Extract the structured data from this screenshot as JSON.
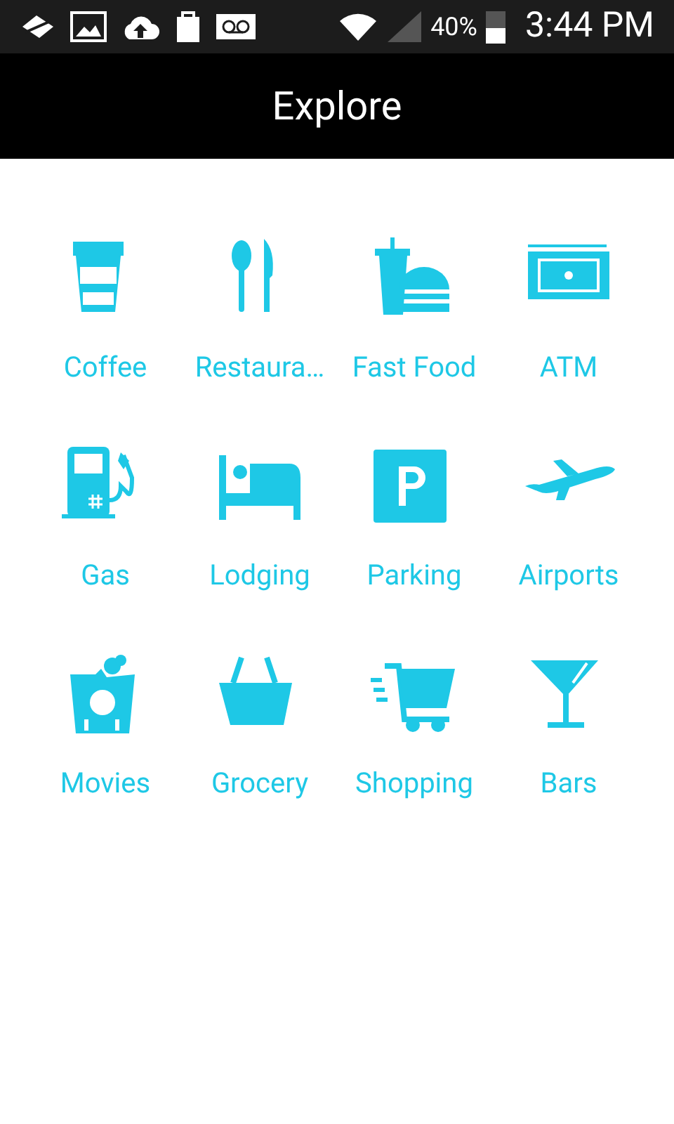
{
  "status_bar": {
    "battery": "40%",
    "time": "3:44 PM"
  },
  "title": "Explore",
  "categories": [
    {
      "label": "Coffee"
    },
    {
      "label": "Restaura…"
    },
    {
      "label": "Fast Food"
    },
    {
      "label": "ATM"
    },
    {
      "label": "Gas"
    },
    {
      "label": "Lodging"
    },
    {
      "label": "Parking"
    },
    {
      "label": "Airports"
    },
    {
      "label": "Movies"
    },
    {
      "label": "Grocery"
    },
    {
      "label": "Shopping"
    },
    {
      "label": "Bars"
    }
  ]
}
